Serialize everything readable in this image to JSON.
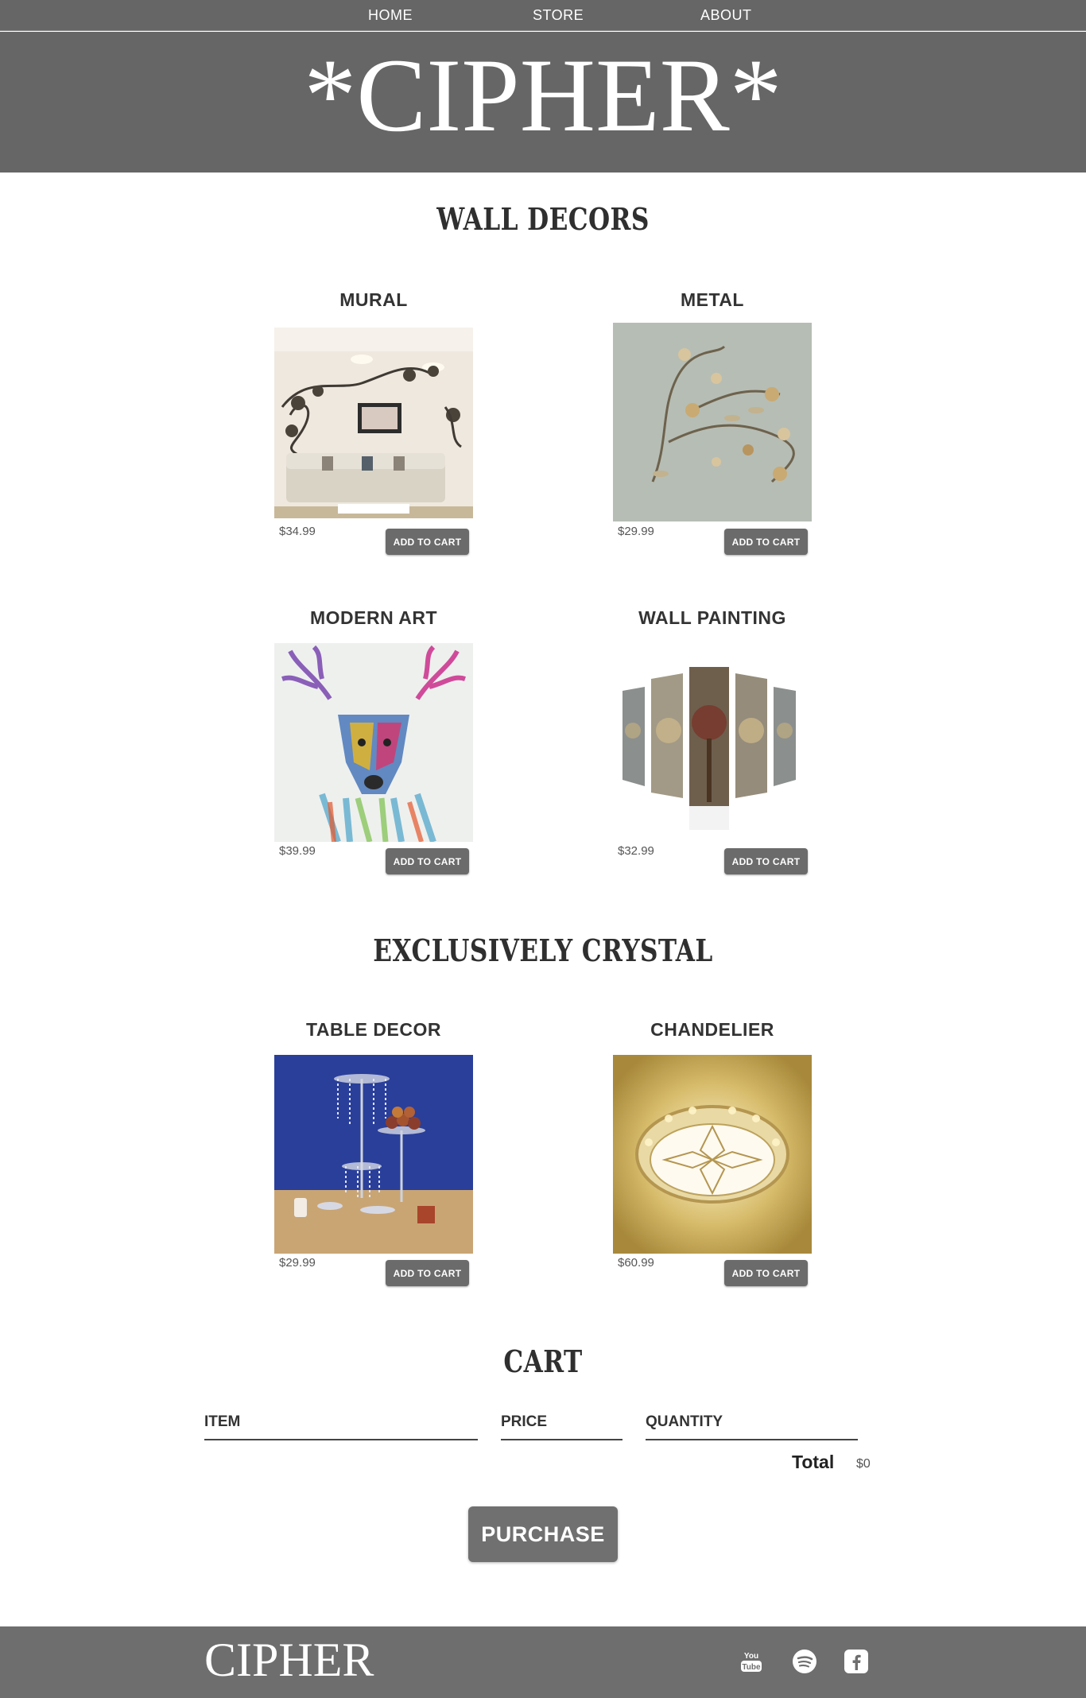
{
  "nav": {
    "home": "HOME",
    "store": "STORE",
    "about": "ABOUT"
  },
  "header": {
    "brand": "*CIPHER*"
  },
  "sections": {
    "wall": {
      "title": "WALL DECORS",
      "items": [
        {
          "name": "MURAL",
          "price": "$34.99",
          "button": "ADD TO CART"
        },
        {
          "name": "METAL",
          "price": "$29.99",
          "button": "ADD TO CART"
        },
        {
          "name": "MODERN ART",
          "price": "$39.99",
          "button": "ADD TO CART"
        },
        {
          "name": "WALL PAINTING",
          "price": "$32.99",
          "button": "ADD TO CART"
        }
      ]
    },
    "crystal": {
      "title": "EXCLUSIVELY CRYSTAL",
      "items": [
        {
          "name": "TABLE DECOR",
          "price": "$29.99",
          "button": "ADD TO CART"
        },
        {
          "name": "CHANDELIER",
          "price": "$60.99",
          "button": "ADD TO CART"
        }
      ]
    }
  },
  "cart": {
    "title": "CART",
    "columns": [
      "ITEM",
      "PRICE",
      "QUANTITY"
    ],
    "total_label": "Total",
    "total_value": "$0",
    "purchase": "PURCHASE"
  },
  "footer": {
    "brand": "CIPHER",
    "social": [
      "youtube-icon",
      "spotify-icon",
      "facebook-icon"
    ]
  },
  "colors": {
    "header_bg": "#666666",
    "button_bg": "#6b6b6b",
    "footer_bg": "#6e6e6e"
  }
}
